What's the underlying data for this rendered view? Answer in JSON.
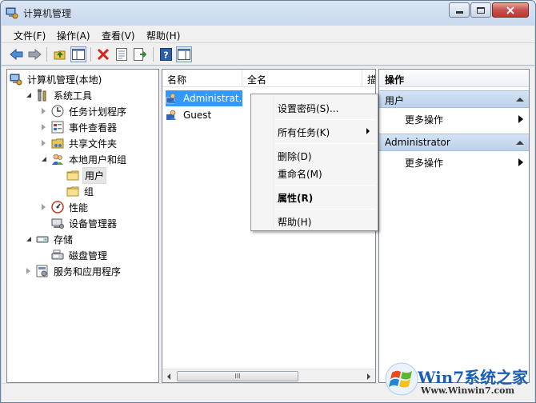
{
  "window": {
    "title": "计算机管理",
    "controls": [
      "minimize-icon",
      "maximize-icon",
      "close-icon"
    ]
  },
  "menubar": [
    {
      "label": "文件(F)"
    },
    {
      "label": "操作(A)"
    },
    {
      "label": "查看(V)"
    },
    {
      "label": "帮助(H)"
    }
  ],
  "toolbar": [
    {
      "icon": "back-arrow-icon"
    },
    {
      "icon": "forward-arrow-icon"
    },
    {
      "icon": "up-folder-icon"
    },
    {
      "icon": "show-hide-tree-icon",
      "pressed": true
    },
    {
      "icon": "delete-icon"
    },
    {
      "icon": "properties-icon"
    },
    {
      "icon": "export-list-icon"
    },
    {
      "icon": "help-icon"
    },
    {
      "icon": "action-pane-icon",
      "pressed": true
    }
  ],
  "tree": [
    {
      "label": "计算机管理(本地)",
      "icon": "computer-management-icon",
      "level": 0,
      "toggle": "none"
    },
    {
      "label": "系统工具",
      "icon": "system-tools-icon",
      "level": 1,
      "toggle": "expanded"
    },
    {
      "label": "任务计划程序",
      "icon": "clock-icon",
      "level": 2,
      "toggle": "collapsed"
    },
    {
      "label": "事件查看器",
      "icon": "event-viewer-icon",
      "level": 2,
      "toggle": "collapsed"
    },
    {
      "label": "共享文件夹",
      "icon": "shared-folder-icon",
      "level": 2,
      "toggle": "collapsed"
    },
    {
      "label": "本地用户和组",
      "icon": "local-users-groups-icon",
      "level": 2,
      "toggle": "expanded"
    },
    {
      "label": "用户",
      "icon": "folder-icon",
      "level": 3,
      "toggle": "none",
      "selected": true
    },
    {
      "label": "组",
      "icon": "folder-icon",
      "level": 3,
      "toggle": "none"
    },
    {
      "label": "性能",
      "icon": "performance-icon",
      "level": 2,
      "toggle": "collapsed"
    },
    {
      "label": "设备管理器",
      "icon": "device-manager-icon",
      "level": 2,
      "toggle": "none"
    },
    {
      "label": "存储",
      "icon": "storage-icon",
      "level": 1,
      "toggle": "expanded"
    },
    {
      "label": "磁盘管理",
      "icon": "disk-management-icon",
      "level": 2,
      "toggle": "none"
    },
    {
      "label": "服务和应用程序",
      "icon": "services-apps-icon",
      "level": 1,
      "toggle": "collapsed"
    }
  ],
  "list": {
    "columns": [
      "名称",
      "全名",
      "描"
    ],
    "rows": [
      {
        "name": "Administrat...",
        "icon": "user-icon",
        "selected": true
      },
      {
        "name": "Guest",
        "icon": "user-icon",
        "selected": false
      }
    ],
    "scroll_grip": "III"
  },
  "actions": {
    "title": "操作",
    "sections": [
      {
        "header": "用户",
        "items": [
          "更多操作"
        ]
      },
      {
        "header": "Administrator",
        "items": [
          "更多操作"
        ]
      }
    ]
  },
  "context_menu": {
    "items": [
      {
        "label": "设置密码(S)...",
        "bold": false,
        "submenu": false
      },
      {
        "separator": true
      },
      {
        "label": "所有任务(K)",
        "bold": false,
        "submenu": true
      },
      {
        "separator": true
      },
      {
        "label": "删除(D)",
        "bold": false,
        "submenu": false
      },
      {
        "label": "重命名(M)",
        "bold": false,
        "submenu": false
      },
      {
        "separator": true
      },
      {
        "label": "属性(R)",
        "bold": true,
        "submenu": false
      },
      {
        "separator": true
      },
      {
        "label": "帮助(H)",
        "bold": false,
        "submenu": false
      }
    ]
  },
  "watermark": {
    "brand": "Win7系统之家",
    "url": "Www.Winwin7.com"
  },
  "colors": {
    "selection": "#3399ff",
    "action_header": "#c7d9ef",
    "title_close": "#c75050"
  }
}
